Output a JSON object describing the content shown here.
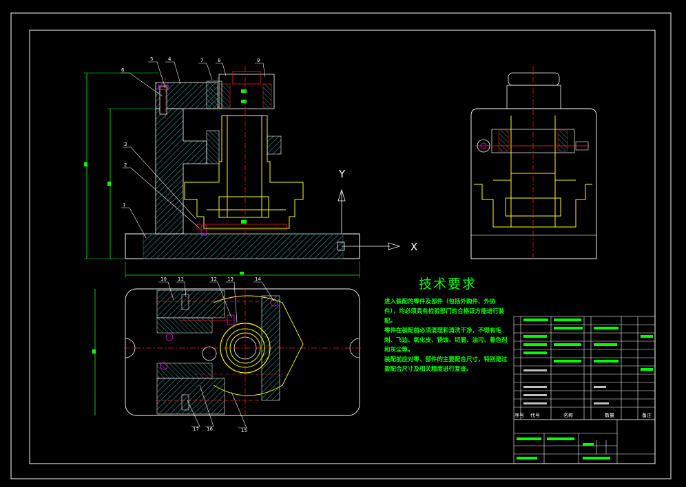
{
  "tech_requirements": {
    "title": "技术要求",
    "lines": [
      "进入装配的零件及部件（包括外购件、外协",
      "件），均必须具有检验部门的合格证方能进行装",
      "配。",
      "零件在装配前必须清理和清洗干净，不得有毛",
      "刺、飞边、氧化皮、锈蚀、切屑、油污、着色剂",
      "和灰尘等。",
      "装配前应对零、部件的主要配合尺寸，特别是过",
      "盈配合尺寸及相关精度进行复查。"
    ]
  },
  "axis_labels": {
    "y": "Y",
    "x": "X"
  },
  "part_callouts": [
    "1",
    "2",
    "3",
    "4",
    "5",
    "6",
    "7",
    "8",
    "9",
    "10",
    "11",
    "12",
    "13",
    "14",
    "15",
    "16",
    "17"
  ],
  "title_block_headers": {
    "seq": "序号",
    "code": "代号",
    "name": "名称",
    "qty": "数量",
    "remark": "备注"
  },
  "colors": {
    "background": "#000000",
    "frame": "#ffffff",
    "hatch": "#2e8b8b",
    "outline": "#ffffff",
    "yellow": "#ffff00",
    "red": "#ff2020",
    "green": "#00ff00",
    "magenta": "#ff00ff"
  }
}
